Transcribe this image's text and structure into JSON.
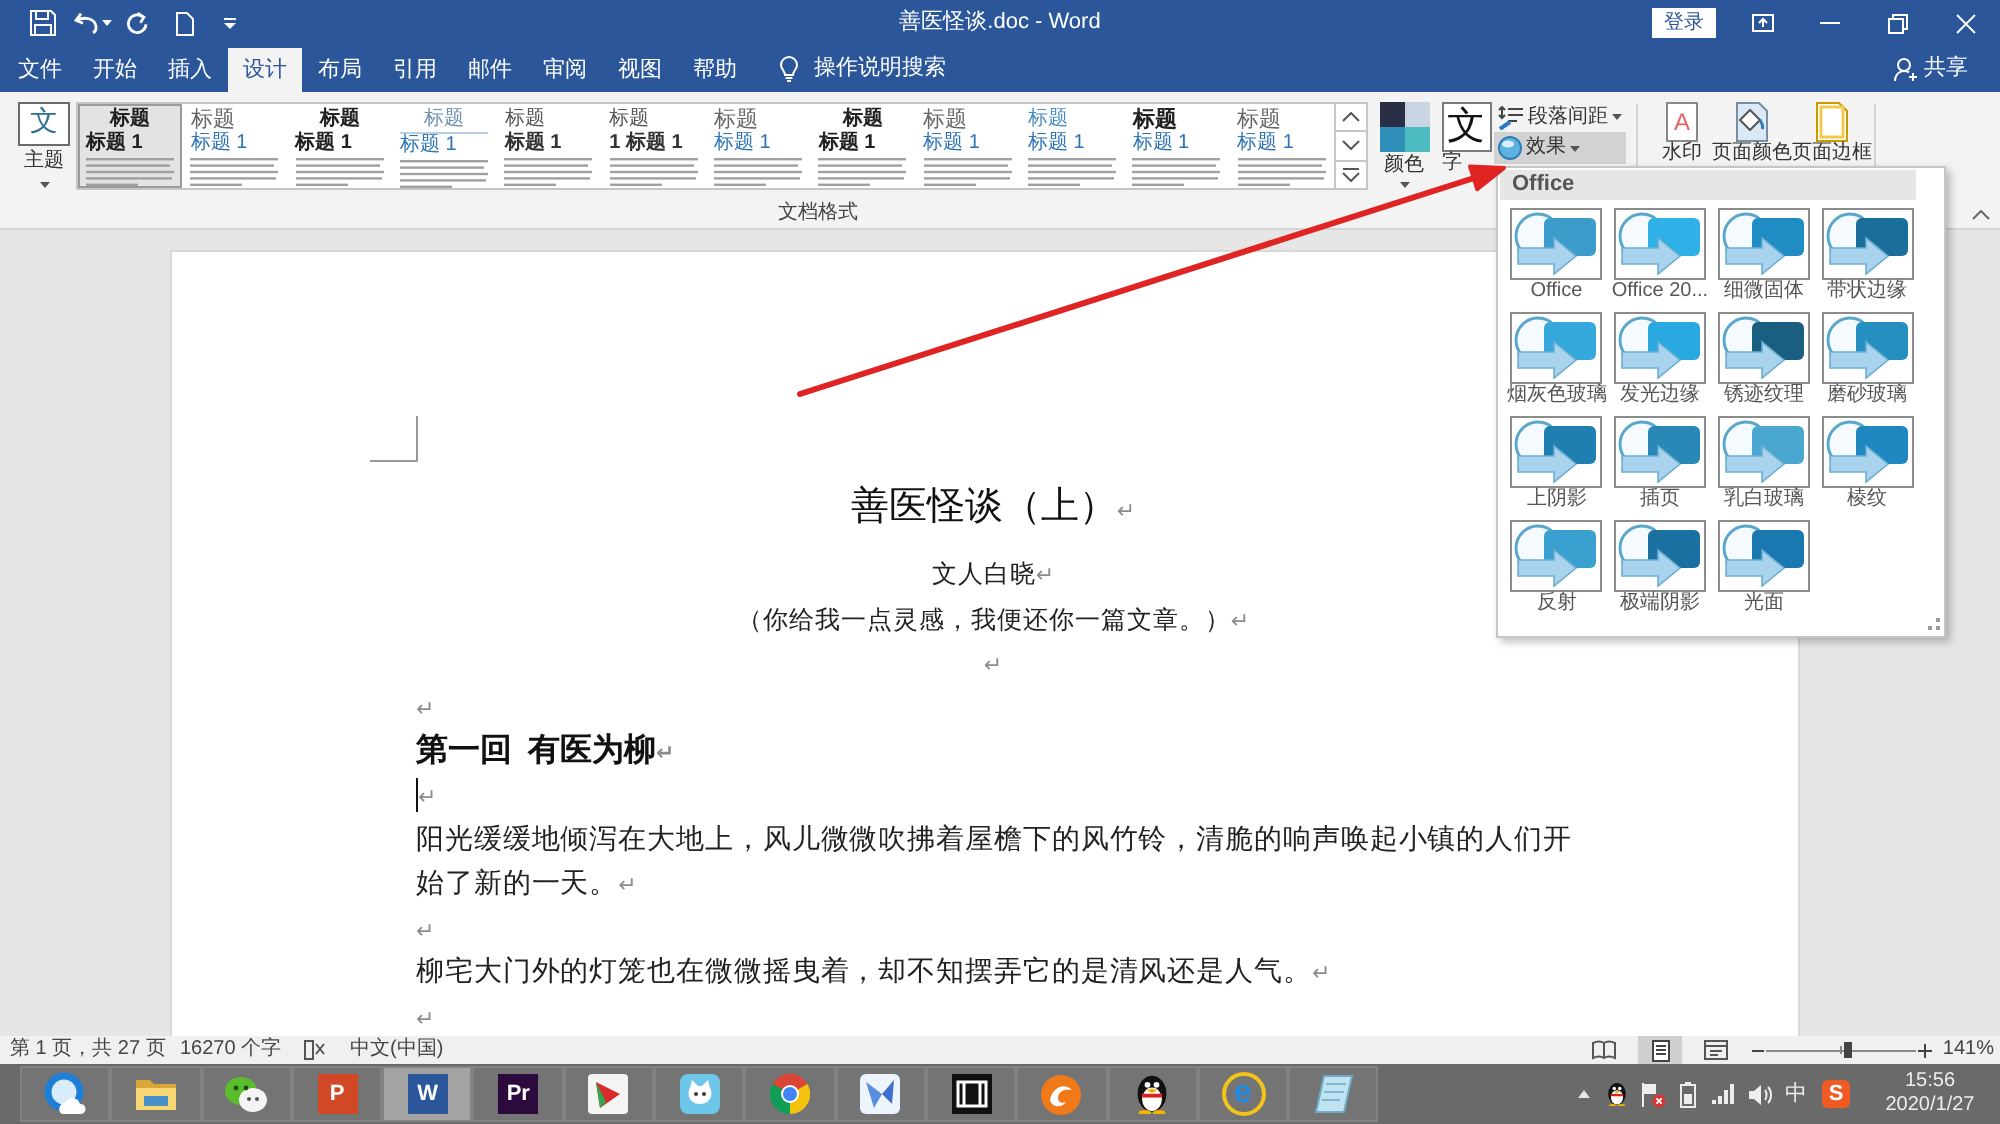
{
  "title_bar": {
    "title": "善医怪谈.doc - Word",
    "sign_in": "登录"
  },
  "tabs": [
    {
      "label": "文件",
      "selected": false
    },
    {
      "label": "开始",
      "selected": false
    },
    {
      "label": "插入",
      "selected": false
    },
    {
      "label": "设计",
      "selected": true
    },
    {
      "label": "布局",
      "selected": false
    },
    {
      "label": "引用",
      "selected": false
    },
    {
      "label": "邮件",
      "selected": false
    },
    {
      "label": "审阅",
      "selected": false
    },
    {
      "label": "视图",
      "selected": false
    },
    {
      "label": "帮助",
      "selected": false
    }
  ],
  "tell_me": {
    "label": "操作说明搜索"
  },
  "share": {
    "label": "共享"
  },
  "ribbon": {
    "theme": {
      "icon_text": "文",
      "label": "主题"
    },
    "style_sets": [
      {
        "kind": "centered",
        "title": "标题",
        "heading": "标题 1",
        "selected": true
      },
      {
        "kind": "large",
        "title": "标题",
        "heading": "标题 1",
        "selected": false
      },
      {
        "kind": "centered",
        "title": "标题",
        "heading": "标题 1",
        "selected": false
      },
      {
        "kind": "ruled",
        "title": "标题",
        "heading": "标题 1",
        "selected": false
      },
      {
        "kind": "plain",
        "title": "标题",
        "heading": "标题 1",
        "selected": false
      },
      {
        "kind": "plain",
        "title": "标题",
        "heading": "1 标题 1",
        "selected": false
      },
      {
        "kind": "large",
        "title": "标题",
        "heading": "标题 1",
        "selected": false
      },
      {
        "kind": "centered",
        "title": "标题",
        "heading": "标题 1",
        "selected": false
      },
      {
        "kind": "large",
        "title": "标题",
        "heading": "标题 1",
        "selected": false
      },
      {
        "kind": "accent",
        "title": "标题",
        "heading": "标题 1",
        "selected": false
      },
      {
        "kind": "bold",
        "title": "标题",
        "heading": "标题 1",
        "selected": false
      },
      {
        "kind": "large",
        "title": "标题",
        "heading": "标题 1",
        "selected": false
      }
    ],
    "colors": {
      "label": "颜色"
    },
    "fonts": {
      "icon_text": "文",
      "label": "字"
    },
    "paragraph_spacing": {
      "label": "段落间距"
    },
    "effects": {
      "label": "效果",
      "pressed": true
    },
    "watermark": {
      "icon_text": "A",
      "label": "水印"
    },
    "page_color": {
      "label": "页面颜色"
    },
    "page_borders": {
      "label": "页面边框"
    },
    "group_label": "文档格式"
  },
  "effects_menu": {
    "header": "Office",
    "items": [
      {
        "label": "Office"
      },
      {
        "label": "Office 20..."
      },
      {
        "label": "细微固体"
      },
      {
        "label": "带状边缘"
      },
      {
        "label": "烟灰色玻璃"
      },
      {
        "label": "发光边缘"
      },
      {
        "label": "锈迹纹理"
      },
      {
        "label": "磨砂玻璃"
      },
      {
        "label": "上阴影"
      },
      {
        "label": "插页"
      },
      {
        "label": "乳白玻璃"
      },
      {
        "label": "棱纹"
      },
      {
        "label": "反射"
      },
      {
        "label": "极端阴影"
      },
      {
        "label": "光面"
      }
    ]
  },
  "document": {
    "paragraphs": [
      {
        "kind": "title",
        "text": "善医怪谈（上）",
        "mark": "↵",
        "cursor": false
      },
      {
        "kind": "centered",
        "text": "文人白晓",
        "mark": "↵",
        "cursor": false
      },
      {
        "kind": "centered",
        "text": "（你给我一点灵感，我便还你一篇文章。）",
        "mark": "↵",
        "cursor": false
      },
      {
        "kind": "centered",
        "mark": "↵",
        "cursor": false
      },
      {
        "kind": "body",
        "mark": "↵",
        "cursor": false
      },
      {
        "kind": "heading",
        "text": "第一回  有医为柳",
        "mark": "↵",
        "cursor": false
      },
      {
        "kind": "body",
        "mark": "↵",
        "cursor": true
      },
      {
        "kind": "body",
        "text": "阳光缓缓地倾泻在大地上，风儿微微吹拂着屋檐下的风竹铃，清脆的响声唤起小镇的人们开始了新的一天。",
        "mark": "↵",
        "cursor": false
      },
      {
        "kind": "body",
        "mark": "↵",
        "cursor": false
      },
      {
        "kind": "body",
        "text": "柳宅大门外的灯笼也在微微摇曳着，却不知摆弄它的是清风还是人气。",
        "mark": "↵",
        "cursor": false
      },
      {
        "kind": "body",
        "mark": "↵",
        "cursor": false
      }
    ]
  },
  "status_bar": {
    "page": "第 1 页，共 27 页",
    "words": "16270 个字",
    "language": "中文(中国)",
    "views": [
      {
        "kind": "read",
        "selected": false
      },
      {
        "kind": "print",
        "selected": true
      },
      {
        "kind": "web",
        "selected": false
      }
    ],
    "zoom": {
      "level": 0.55,
      "reading": "141%"
    }
  },
  "taskbar": {
    "apps": [
      {
        "kind": "cloud-orb",
        "selected": false
      },
      {
        "kind": "folder",
        "selected": false
      },
      {
        "kind": "chat",
        "selected": false
      },
      {
        "kind": "tile",
        "glyph": "P",
        "color": "#d24726",
        "selected": false
      },
      {
        "kind": "tile",
        "glyph": "W",
        "color": "#2b579a",
        "selected": true
      },
      {
        "kind": "tile",
        "glyph": "Pr",
        "color": "#2c0a3e",
        "selected": false
      },
      {
        "kind": "flag-tile",
        "selected": false
      },
      {
        "kind": "cat",
        "selected": false
      },
      {
        "kind": "segmented-orb",
        "selected": false
      },
      {
        "kind": "bird",
        "selected": false
      },
      {
        "kind": "film",
        "selected": false
      },
      {
        "kind": "swirl-orb",
        "selected": false
      },
      {
        "kind": "penguin",
        "selected": false
      },
      {
        "kind": "e-logo",
        "glyph": "e",
        "selected": false
      },
      {
        "kind": "notepad",
        "selected": false
      }
    ],
    "tray": {
      "input_mode": "中",
      "ime_logo": "S",
      "time": "15:56",
      "date": "2020/1/27"
    }
  }
}
